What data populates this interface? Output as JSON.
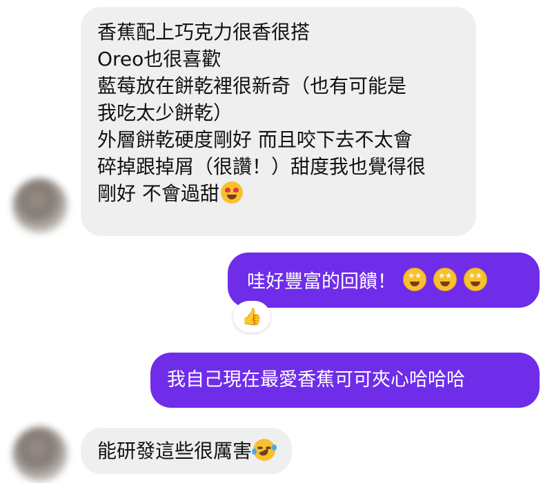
{
  "messages": [
    {
      "sender": "other",
      "lines": [
        "香蕉配上巧克力很香很搭",
        "Oreo也很喜歡",
        "藍莓放在餅乾裡很新奇（也有可能是",
        "我吃太少餅乾）",
        "外層餅乾硬度剛好 而且咬下去不太會",
        "碎掉跟掉屑（很讚！）甜度我也覺得很",
        "剛好 不會過甜"
      ],
      "emoji": "heart-eyes"
    },
    {
      "sender": "me",
      "text": "哇好豐富的回饋！",
      "emojis": [
        "star-struck",
        "star-struck",
        "star-struck"
      ],
      "reaction": "thumbs-up"
    },
    {
      "sender": "me",
      "text": "我自己現在最愛香蕉可可夾心哈哈哈"
    },
    {
      "sender": "other",
      "text": "能研發這些很厲害",
      "emoji": "rolling-on-floor-laughing"
    }
  ],
  "colors": {
    "outgoing_bubble": "#6f2dea",
    "incoming_bubble": "#efeff0",
    "outgoing_text": "#ffffff",
    "incoming_text": "#111111"
  }
}
